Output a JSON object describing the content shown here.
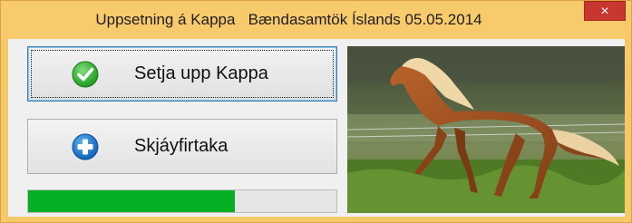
{
  "window": {
    "title": "Uppsetning á Kappa   Bændasamtök Íslands 05.05.2014",
    "close_label": "×"
  },
  "buttons": {
    "install_label": "Setja upp Kappa",
    "remote_label": "Skjáyfirtaka"
  },
  "progress": {
    "fraction": 0.67,
    "color": "#06b025"
  },
  "icons": {
    "install": "checkmark-circle-icon",
    "remote": "plus-circle-icon"
  },
  "colors": {
    "titlebar": "#f7ca6b",
    "close": "#c7372f"
  }
}
